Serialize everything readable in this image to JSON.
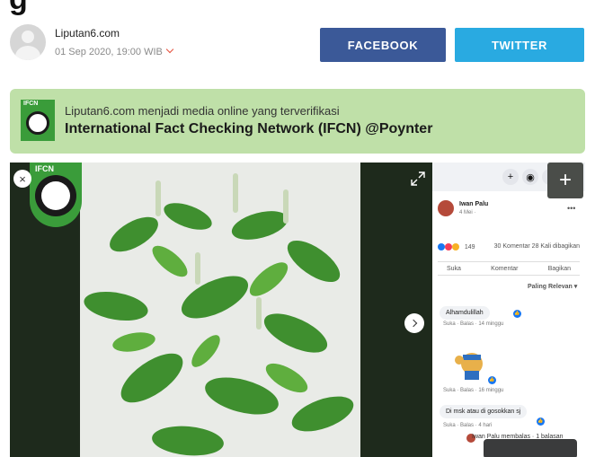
{
  "author": {
    "name": "Liputan6.com",
    "date": "01 Sep 2020, 19:00 WIB"
  },
  "share": {
    "facebook_label": "FACEBOOK",
    "twitter_label": "TWITTER"
  },
  "ifcn_banner": {
    "line1": "Liputan6.com menjadi media online yang terverifikasi",
    "line2": "International Fact Checking Network (IFCN) @Poynter",
    "logo_label": "IFCN"
  },
  "media": {
    "badge_label": "IFCN",
    "close_glyph": "×",
    "add_glyph": "+"
  },
  "fb_post": {
    "author": "Iwan Palu",
    "date": "4 Mei · ",
    "reactions_count": "149",
    "comments_shares": "30 Komentar  28 Kali dibagikan",
    "actions": [
      "Suka",
      "Komentar",
      "Bagikan"
    ],
    "sort_label": "Paling Relevan ▾",
    "comments": [
      {
        "text": "Alhamdulillah",
        "meta": "Suka · Balas · 14 minggu"
      },
      {
        "text": "",
        "meta": "Suka · Balas · 16 minggu"
      },
      {
        "text": "Di msk atau di gosokkan sj",
        "meta": "Suka · Balas · 4 hari"
      }
    ],
    "reply_text": "Iwan Palu membalas · 1 balasan"
  },
  "colors": {
    "facebook": "#3b5998",
    "twitter": "#29aae1",
    "ifcn_bg": "#bfe0a8",
    "ifcn_green": "#3a9c3a"
  }
}
